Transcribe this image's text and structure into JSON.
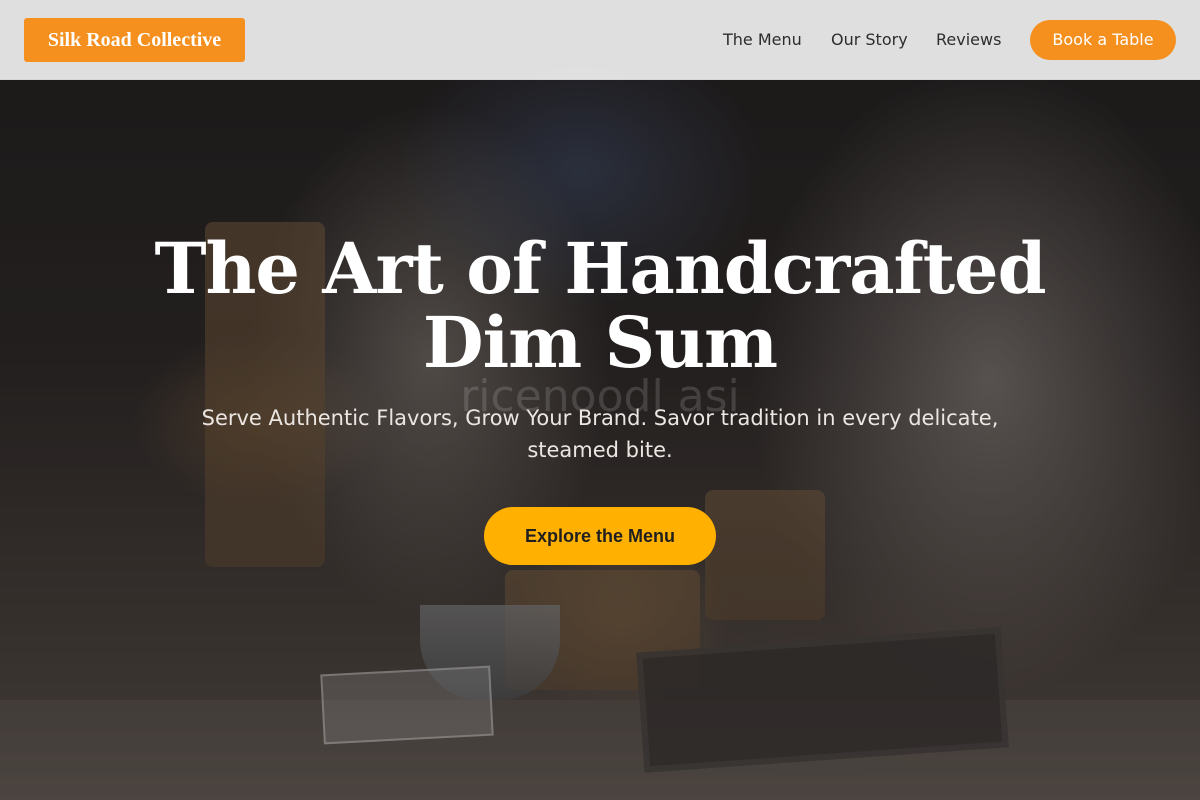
{
  "brand": {
    "name": "Silk Road Collective",
    "accent_color": "#f5901e"
  },
  "nav": {
    "links": [
      "The Menu",
      "Our Story",
      "Reviews"
    ],
    "cta_label": "Book a Table"
  },
  "hero": {
    "title_line1": "The Art of Handcrafted",
    "title_line2": "Dim Sum",
    "background_text": "ricenoodl asi",
    "subtitle_line1": "Serve Authentic Flavors, Grow Your Brand. Savor tradition in every delicate,",
    "subtitle_line2": "steamed bite.",
    "cta_label": "Explore the Menu",
    "cta_color": "#ffb000"
  }
}
